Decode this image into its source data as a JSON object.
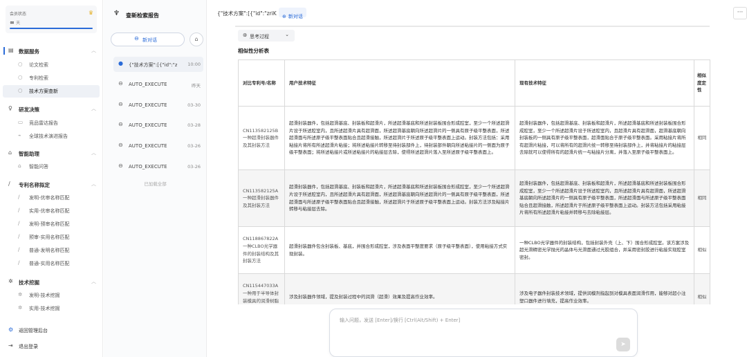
{
  "sidebar": {
    "member_title": "会员状态",
    "quota_value": "∞",
    "quota_unit": "天",
    "quota_progress": 1.0,
    "groups": {
      "data": {
        "label": "数据服务",
        "icon": "database-icon"
      },
      "research": {
        "label": "研发决策",
        "icon": "bulb-icon"
      },
      "assist": {
        "label": "智能助理",
        "icon": "robot-icon"
      },
      "patent": {
        "label": "专利名称拟定",
        "icon": "pen-icon"
      },
      "mining": {
        "label": "技术挖掘",
        "icon": "sparkle-icon"
      }
    },
    "items": {
      "paper": "论文检索",
      "patent_search": "专利检索",
      "tech_check": "技术方案查新",
      "product_radar": "竞品雷达报告",
      "global_evolution": "全球技术演进报告",
      "smart_qa": "智能问答",
      "inv_opt": "发明-优审名称匹配",
      "util_opt": "实用-优审名称匹配",
      "inv_pre": "发明-预审名称匹配",
      "pre_util": "预审-实用名称匹配",
      "normal_inv": "普通-发明名称匹配",
      "normal_util": "普通-实用名称匹配",
      "mine_inv": "发明-技术挖掘",
      "mine_util": "实用-技术挖掘"
    },
    "admin": "返回管理后台",
    "logout": "退出登录"
  },
  "history": {
    "title": "查新检索报告",
    "new_chat": "新对话",
    "sessions": [
      {
        "name": "{\"技术方案\":[{\"id\":\"zriK",
        "time": "10:00"
      },
      {
        "name": "AUTO_EXECUTE",
        "time": "昨天"
      },
      {
        "name": "AUTO_EXECUTE",
        "time": "03-30"
      },
      {
        "name": "AUTO_EXECUTE",
        "time": "03-28"
      },
      {
        "name": "AUTO_EXECUTE",
        "time": "03-26"
      },
      {
        "name": "AUTO_EXECUTE",
        "time": "03-26"
      }
    ],
    "loaded_all": "已加载全部"
  },
  "main": {
    "topbar_title": "{\"技术方案\":[{\"id\":\"zriK",
    "new_chat": "新对话",
    "more": "···",
    "think": "思考过程",
    "section_title": "相似性分析表",
    "table_headers": [
      "对比专利号/名称",
      "用户技术特征",
      "现有技术特征",
      "相似度定性"
    ],
    "rows": [
      {
        "patent": "CN113582125B一种超滑封装器件及其封装方法",
        "user": "超滑封装器件，包括超滑基底、封装板和超滑片，所述超滑基底和所述封装板围合形成腔室，至少一个所述超滑片设于所述腔室内，且所述超滑片具有超滑面，所述超滑基底朝向所述超滑片的一侧具有原子级平整表面，所述超滑面与所述原子级平整表面贴合且超滑接触，所述超滑片于所述原子级平整表面上运动。封装方法包括：采用粘接片将所有所述超滑片粘接；将所述粘接片转移至待封装部件上，待封装部件朝向所述粘接片的一侧面为原子级平整表面；将所述粘接片或所述粘接片的粘接层去除，使得所述超滑片落入至所述原子级平整表面上。",
        "prior": "超滑封装器件，包括超滑基底、封装板和超滑片，所述超滑基底和所述封装板围合形成腔室，至少一个所述超滑片设于所述腔室内，且超滑片具有超滑面，超滑基底朝向封装板的一侧具有原子级平整表面，超滑面贴合于原子级平整表面。采用粘接片将所有超滑片粘接，可以将所有的超滑片统一转移至待封装部件上，并将粘接片的粘接层去除就可以使得所有的超滑片统一与粘接片分离，并落入至原子级平整表面上。",
        "level": "相同"
      },
      {
        "patent": "CN113582125A一种超滑封装器件及其封装方法",
        "user": "超滑封装器件，包括超滑基底、封装板和超滑片，所述超滑基底和所述封装板围合形成腔室，至少一个所述超滑片设于所述腔室内，且所述超滑片具有超滑面，所述超滑基底朝向所述超滑片的一侧具有原子级平整表面，所述超滑面与所述原子级平整表面贴合且超滑接触，所述超滑片于所述原子级平整表面上运动。封装方法涉及粘接片转移与粘接层去除。",
        "prior": "超滑封装器件，包括超滑基底、封装板和超滑片，所述超滑基底和所述封装板围合形成腔室，至少一个所述超滑片设于所述腔室内，且所述超滑片具有超滑面，所述超滑基底朝向所述超滑片的一侧具有原子级平整表面，所述超滑面与所述原子级平整表面贴合且超滑接触，所述超滑片于所述原子级平整表面上运动。封装方法包括采用粘接片将所有所述超滑片粘接并转移与去除粘接层。",
        "level": "相同"
      },
      {
        "patent": "CN118867822A一种CLBO光学器件的封装结构及其封装方法",
        "user": "超滑封装器件包含封装板、基底，并围合形成腔室，涉及表面平整度要求（原子级平整表面），使用粘接方式实现封装。",
        "prior": "一种CLBO光学器件的封装结构，包括封装外壳（上、下）围合形成腔室。该方案涉及超光滑精密光学抛光的晶体与光滑面通过光胶组合，并采用密封胶进行粘接实现腔室密封。",
        "level": "相似"
      },
      {
        "patent": "CN115447033A一种用于半导体封装模具的润滑树脂及其",
        "user": "涉及封装器件领域，提及封装过程中的润滑（超滑）效果及提高作业效率。",
        "prior": "涉及电子器件封装技术领域，提供润模剂指起到对模具表面润滑作用，能够对超小注塑口器件进行填充，提高作业效率。",
        "level": "相似"
      }
    ],
    "input_placeholder": "输入问题，发送 [Enter]/换行 [Ctrl(Alt/Shift) + Enter]"
  }
}
